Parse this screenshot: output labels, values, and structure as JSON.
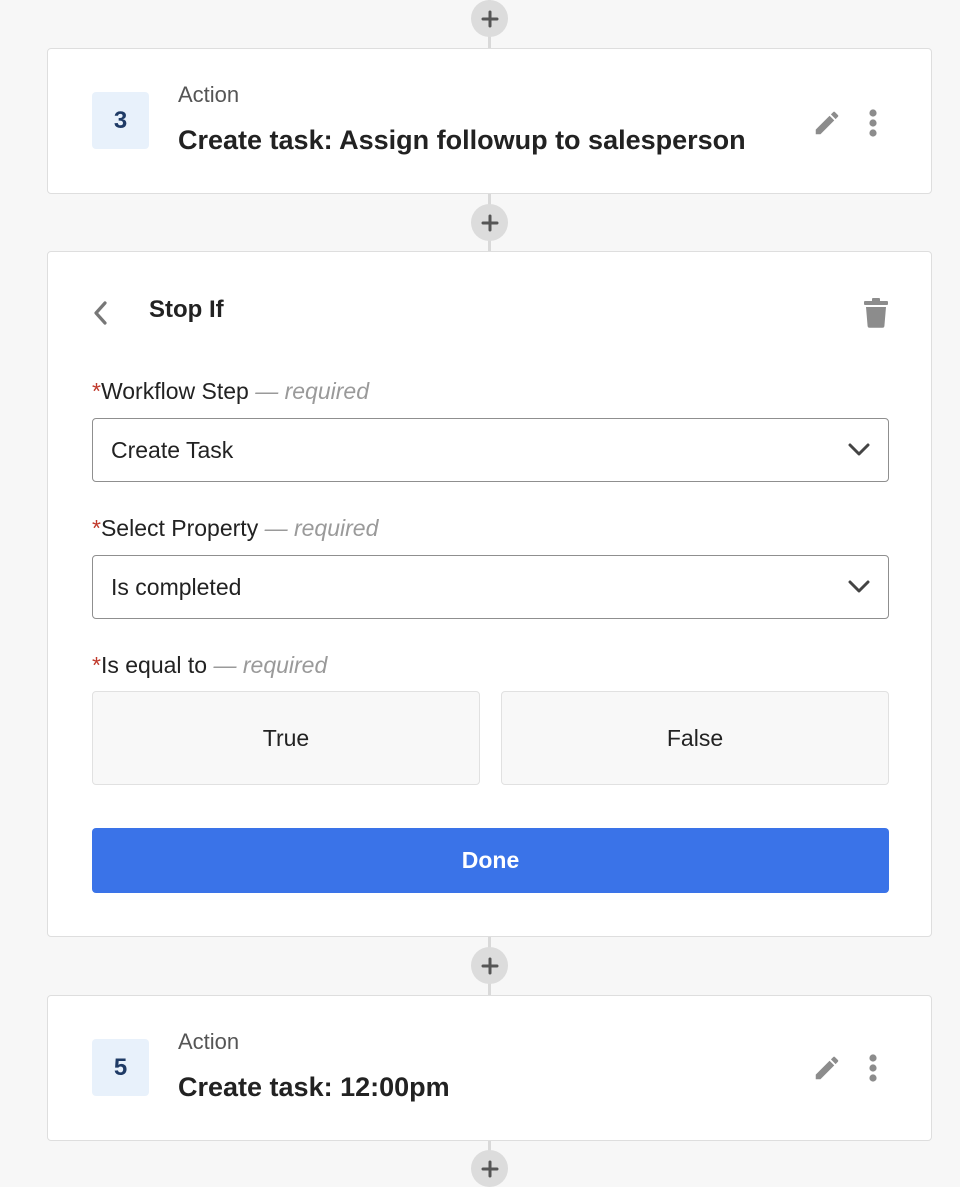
{
  "step3": {
    "number": "3",
    "type": "Action",
    "title": "Create task: Assign followup to salesperson"
  },
  "stop_if": {
    "title": "Stop If",
    "required_marker": "*",
    "required_text": "— required",
    "workflow_step": {
      "label": "Workflow Step",
      "value": "Create Task"
    },
    "select_property": {
      "label": "Select Property",
      "value": "Is completed"
    },
    "is_equal_to": {
      "label": "Is equal to",
      "options": [
        "True",
        "False"
      ]
    },
    "done_label": "Done"
  },
  "step5": {
    "number": "5",
    "type": "Action",
    "title": "Create task: 12:00pm"
  },
  "icons": {
    "add": "plus-icon",
    "edit": "pencil-icon",
    "more": "kebab-icon",
    "back": "chevron-left-icon",
    "delete": "trash-icon",
    "dropdown": "chevron-down-icon"
  },
  "colors": {
    "primary": "#3a73e8",
    "required_star": "#c0392b",
    "step_badge_bg": "#e8f1fb",
    "step_badge_text": "#1f3b66"
  }
}
